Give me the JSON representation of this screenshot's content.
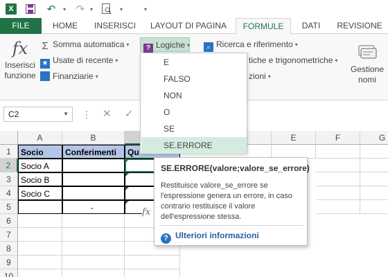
{
  "qat": {
    "app_icon": "excel-icon",
    "app_letter": "X",
    "save_icon": "save-icon",
    "undo_icon": "undo-icon",
    "redo_icon": "redo-icon",
    "preview_icon": "print-preview-icon",
    "dropdown_glyph": "▾"
  },
  "tabs": [
    {
      "label": "FILE"
    },
    {
      "label": "HOME"
    },
    {
      "label": "INSERISCI"
    },
    {
      "label": "LAYOUT DI PAGINA"
    },
    {
      "label": "FORMULE"
    },
    {
      "label": "DATI"
    },
    {
      "label": "REVISIONE"
    }
  ],
  "ribbon": {
    "insert_function": {
      "line1": "Inserisci",
      "line2": "funzione",
      "glyph": "fx"
    },
    "autosum": "Somma automatica",
    "recent": "Usate di recente",
    "financial": "Finanziarie",
    "logical": "Logiche",
    "lookup": "Ricerca e riferimento",
    "math_trig": "tiche e trigonometriche",
    "more_functions": "zioni",
    "name_manager": {
      "line1": "Gestione",
      "line2": "nomi"
    }
  },
  "formula_bar": {
    "name_box": "C2",
    "cancel_glyph": "✕",
    "enter_glyph": "✓",
    "fx_glyph": "fx"
  },
  "grid": {
    "columns": [
      "A",
      "B",
      "C",
      "D",
      "E",
      "F",
      "G"
    ],
    "rows": [
      "1",
      "2",
      "3",
      "4",
      "5",
      "6",
      "7",
      "8",
      "9",
      "10"
    ],
    "cells": {
      "A1": "Socio",
      "B1": "Conferimenti",
      "C1": "Qu",
      "A2": "Socio A",
      "A3": "Socio B",
      "A4": "Socio C",
      "B5": "-"
    }
  },
  "menu": {
    "items": [
      "E",
      "FALSO",
      "NON",
      "O",
      "SE",
      "SE.ERRORE"
    ],
    "highlighted": "SE.ERRORE"
  },
  "tooltip": {
    "title": "SE.ERRORE(valore;valore_se_errore)",
    "description": "Restituisce valore_se_errore se l'espressione genera un errore, in caso contrario restituisce il valore dell'espressione stessa.",
    "help_link": "Ulteriori informazioni",
    "help_icon_glyph": "?"
  },
  "colors": {
    "excel_green": "#217346",
    "header_fill": "#b4c6e7",
    "menu_hover": "#d5ebdf",
    "link_blue": "#2a5d9f"
  }
}
